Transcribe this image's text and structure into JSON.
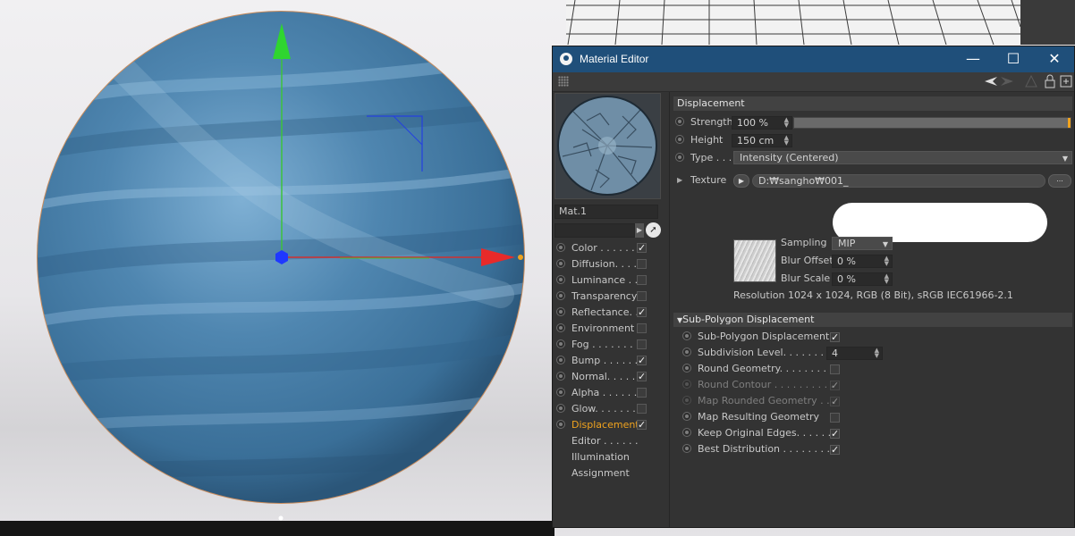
{
  "window": {
    "title": "Material Editor"
  },
  "window_controls": {
    "minimize": "—",
    "maximize": "☐",
    "close": "✕"
  },
  "material": {
    "name": "Mat.1"
  },
  "channels": [
    {
      "label": "Color . . . . . .",
      "checked": true
    },
    {
      "label": "Diffusion. . . .",
      "checked": false
    },
    {
      "label": "Luminance . . .",
      "checked": false
    },
    {
      "label": "Transparency",
      "checked": false
    },
    {
      "label": "Reflectance. .",
      "checked": true
    },
    {
      "label": "Environment",
      "checked": false
    },
    {
      "label": "Fog . . . . . . . .",
      "checked": false
    },
    {
      "label": "Bump . . . . . .",
      "checked": true
    },
    {
      "label": "Normal. . . . .",
      "checked": true
    },
    {
      "label": "Alpha . . . . . .",
      "checked": false
    },
    {
      "label": "Glow. . . . . . .",
      "checked": false
    },
    {
      "label": "Displacement",
      "checked": true,
      "active": true
    },
    {
      "label": "Editor . . . . . .",
      "no_toggle": true
    },
    {
      "label": "Illumination",
      "no_toggle": true
    },
    {
      "label": "Assignment",
      "no_toggle": true
    }
  ],
  "displacement": {
    "header": "Displacement",
    "strength_label": "Strength",
    "strength_value": "100 %",
    "strength_fraction": 1.0,
    "height_label": "Height",
    "height_value": "150 cm",
    "type_label": "Type . . .",
    "type_value": "Intensity (Centered)",
    "texture_label": "Texture",
    "texture_path": "D:₩sangho₩001_",
    "texture_more": "...",
    "sampling_label": "Sampling",
    "sampling_value": "MIP",
    "blur_offset_label": "Blur Offset",
    "blur_offset_value": "0 %",
    "blur_scale_label": "Blur Scale",
    "blur_scale_value": "0 %",
    "resolution": "Resolution 1024 x 1024, RGB (8 Bit), sRGB IEC61966-2.1"
  },
  "subpoly": {
    "header": "Sub-Polygon Displacement",
    "items": [
      {
        "label": "Sub-Polygon Displacement",
        "checked": true,
        "enabled": true
      },
      {
        "label": "Subdivision Level. . . . . . . . .",
        "value": "4",
        "enabled": true
      },
      {
        "label": "Round Geometry. . . . . . . . .",
        "checked": false,
        "enabled": true
      },
      {
        "label": "Round Contour . . . . . . . . . .",
        "checked": true,
        "enabled": false
      },
      {
        "label": "Map Rounded Geometry . . .",
        "checked": true,
        "enabled": false
      },
      {
        "label": "Map Resulting Geometry",
        "checked": false,
        "enabled": true
      },
      {
        "label": "Keep Original Edges. . . . . .",
        "checked": true,
        "enabled": true
      },
      {
        "label": "Best Distribution . . . . . . . .",
        "checked": true,
        "enabled": true
      }
    ]
  },
  "colors": {
    "accent": "#f0a31e",
    "titlebar": "#1f4f7a",
    "panel": "#333333"
  },
  "icons": [
    "material-logo-icon",
    "grip-icon",
    "back-arrow-icon",
    "forward-arrow-icon",
    "up-arrow-icon",
    "lock-icon",
    "new-window-icon",
    "pick-icon",
    "play-icon"
  ]
}
